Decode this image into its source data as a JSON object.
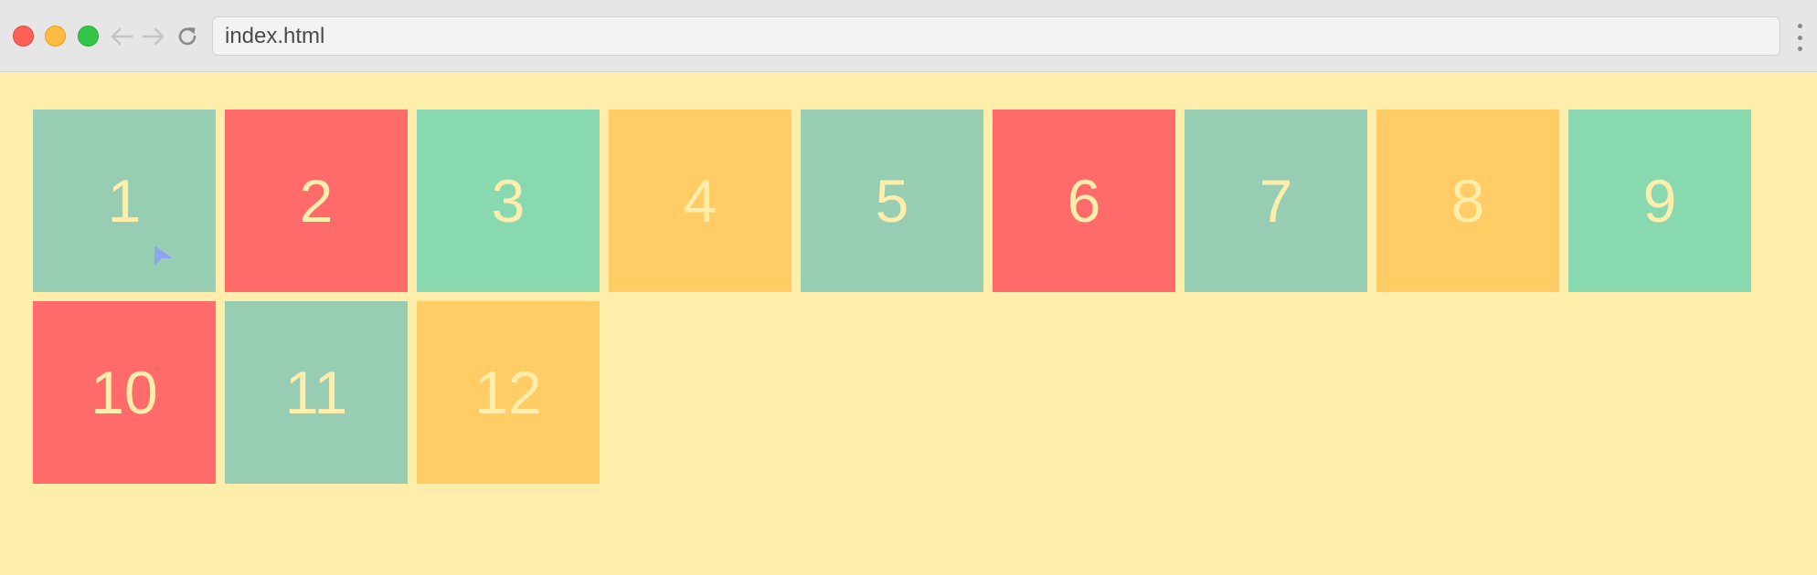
{
  "browser": {
    "address": "index.html",
    "icons": {
      "back": "arrow-left-icon",
      "forward": "arrow-right-icon",
      "reload": "reload-icon",
      "menu": "more-vertical-icon"
    }
  },
  "colors": {
    "background": "#ffeeab",
    "text": "#ffeeab",
    "red": "#ff6b6b",
    "sage": "#96cdb3",
    "mint": "#88d8b0",
    "orange": "#ffcc66"
  },
  "tiles": [
    {
      "label": "1",
      "color": "#96cdb3"
    },
    {
      "label": "2",
      "color": "#ff6b6b"
    },
    {
      "label": "3",
      "color": "#88d8b0"
    },
    {
      "label": "4",
      "color": "#ffcc66"
    },
    {
      "label": "5",
      "color": "#96cdb3"
    },
    {
      "label": "6",
      "color": "#ff6b6b"
    },
    {
      "label": "7",
      "color": "#96cdb3"
    },
    {
      "label": "8",
      "color": "#ffcc66"
    },
    {
      "label": "9",
      "color": "#88d8b0"
    },
    {
      "label": "10",
      "color": "#ff6b6b"
    },
    {
      "label": "11",
      "color": "#96cdb3"
    },
    {
      "label": "12",
      "color": "#ffcc66"
    }
  ]
}
